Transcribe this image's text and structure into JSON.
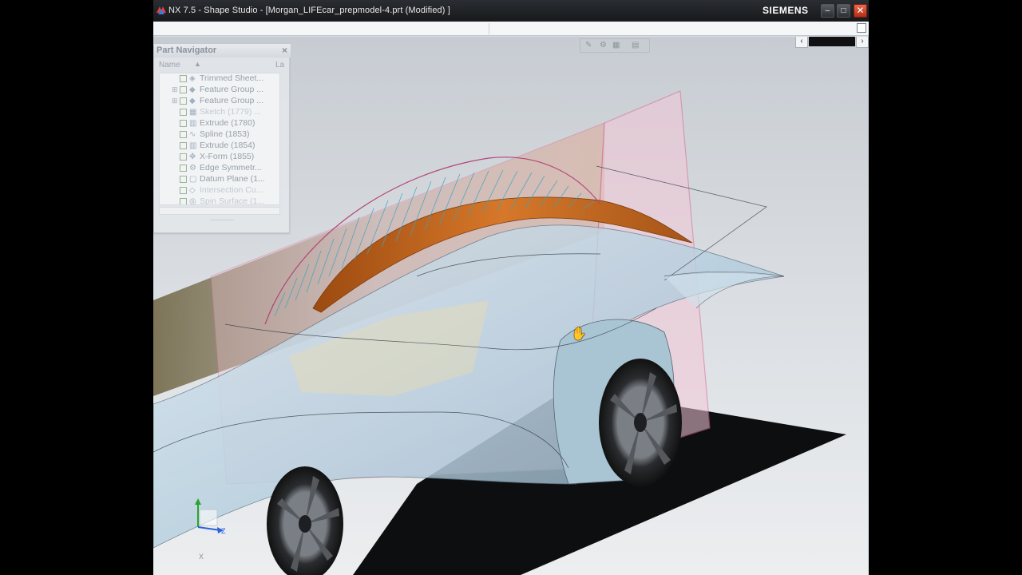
{
  "window": {
    "title": "NX 7.5 - Shape Studio - [Morgan_LIFEcar_prepmodel-4.prt (Modified) ]",
    "brand": "SIEMENS",
    "controls": {
      "minimize": "–",
      "maximize": "□",
      "close": "✕"
    }
  },
  "part_navigator": {
    "title": "Part Navigator",
    "close": "×",
    "columns": {
      "name": "Name",
      "second": "La"
    },
    "items": [
      {
        "label": "Trimmed Sheet...",
        "icon": "sheet-icon"
      },
      {
        "label": "Feature Group ...",
        "icon": "feature-group-icon",
        "expandable": true
      },
      {
        "label": "Feature Group ...",
        "icon": "feature-group-icon",
        "expandable": true
      },
      {
        "label": "Sketch (1779) ...",
        "icon": "sketch-icon",
        "faded": true
      },
      {
        "label": "Extrude (1780)",
        "icon": "extrude-icon"
      },
      {
        "label": "Spline (1853)",
        "icon": "spline-icon"
      },
      {
        "label": "Extrude (1854)",
        "icon": "extrude-icon"
      },
      {
        "label": "X-Form (1855)",
        "icon": "xform-icon"
      },
      {
        "label": "Edge Symmetr...",
        "icon": "edge-symmetry-icon"
      },
      {
        "label": "Datum Plane (1...",
        "icon": "datum-plane-icon"
      },
      {
        "label": "Intersection Cu...",
        "icon": "intersection-curve-icon",
        "faded": true
      },
      {
        "label": "Spin Surface (1...",
        "icon": "spin-surface-icon",
        "faded": true
      }
    ]
  },
  "triad": {
    "y": "Y",
    "z": "Z",
    "x": "X"
  },
  "colors": {
    "titlebar": "#1c1e21",
    "surface_orange": "#c8651a",
    "datum_plane": "#e07aa0",
    "glass_body": "#bcd6e6",
    "comb_curve": "#3aa3c0"
  }
}
